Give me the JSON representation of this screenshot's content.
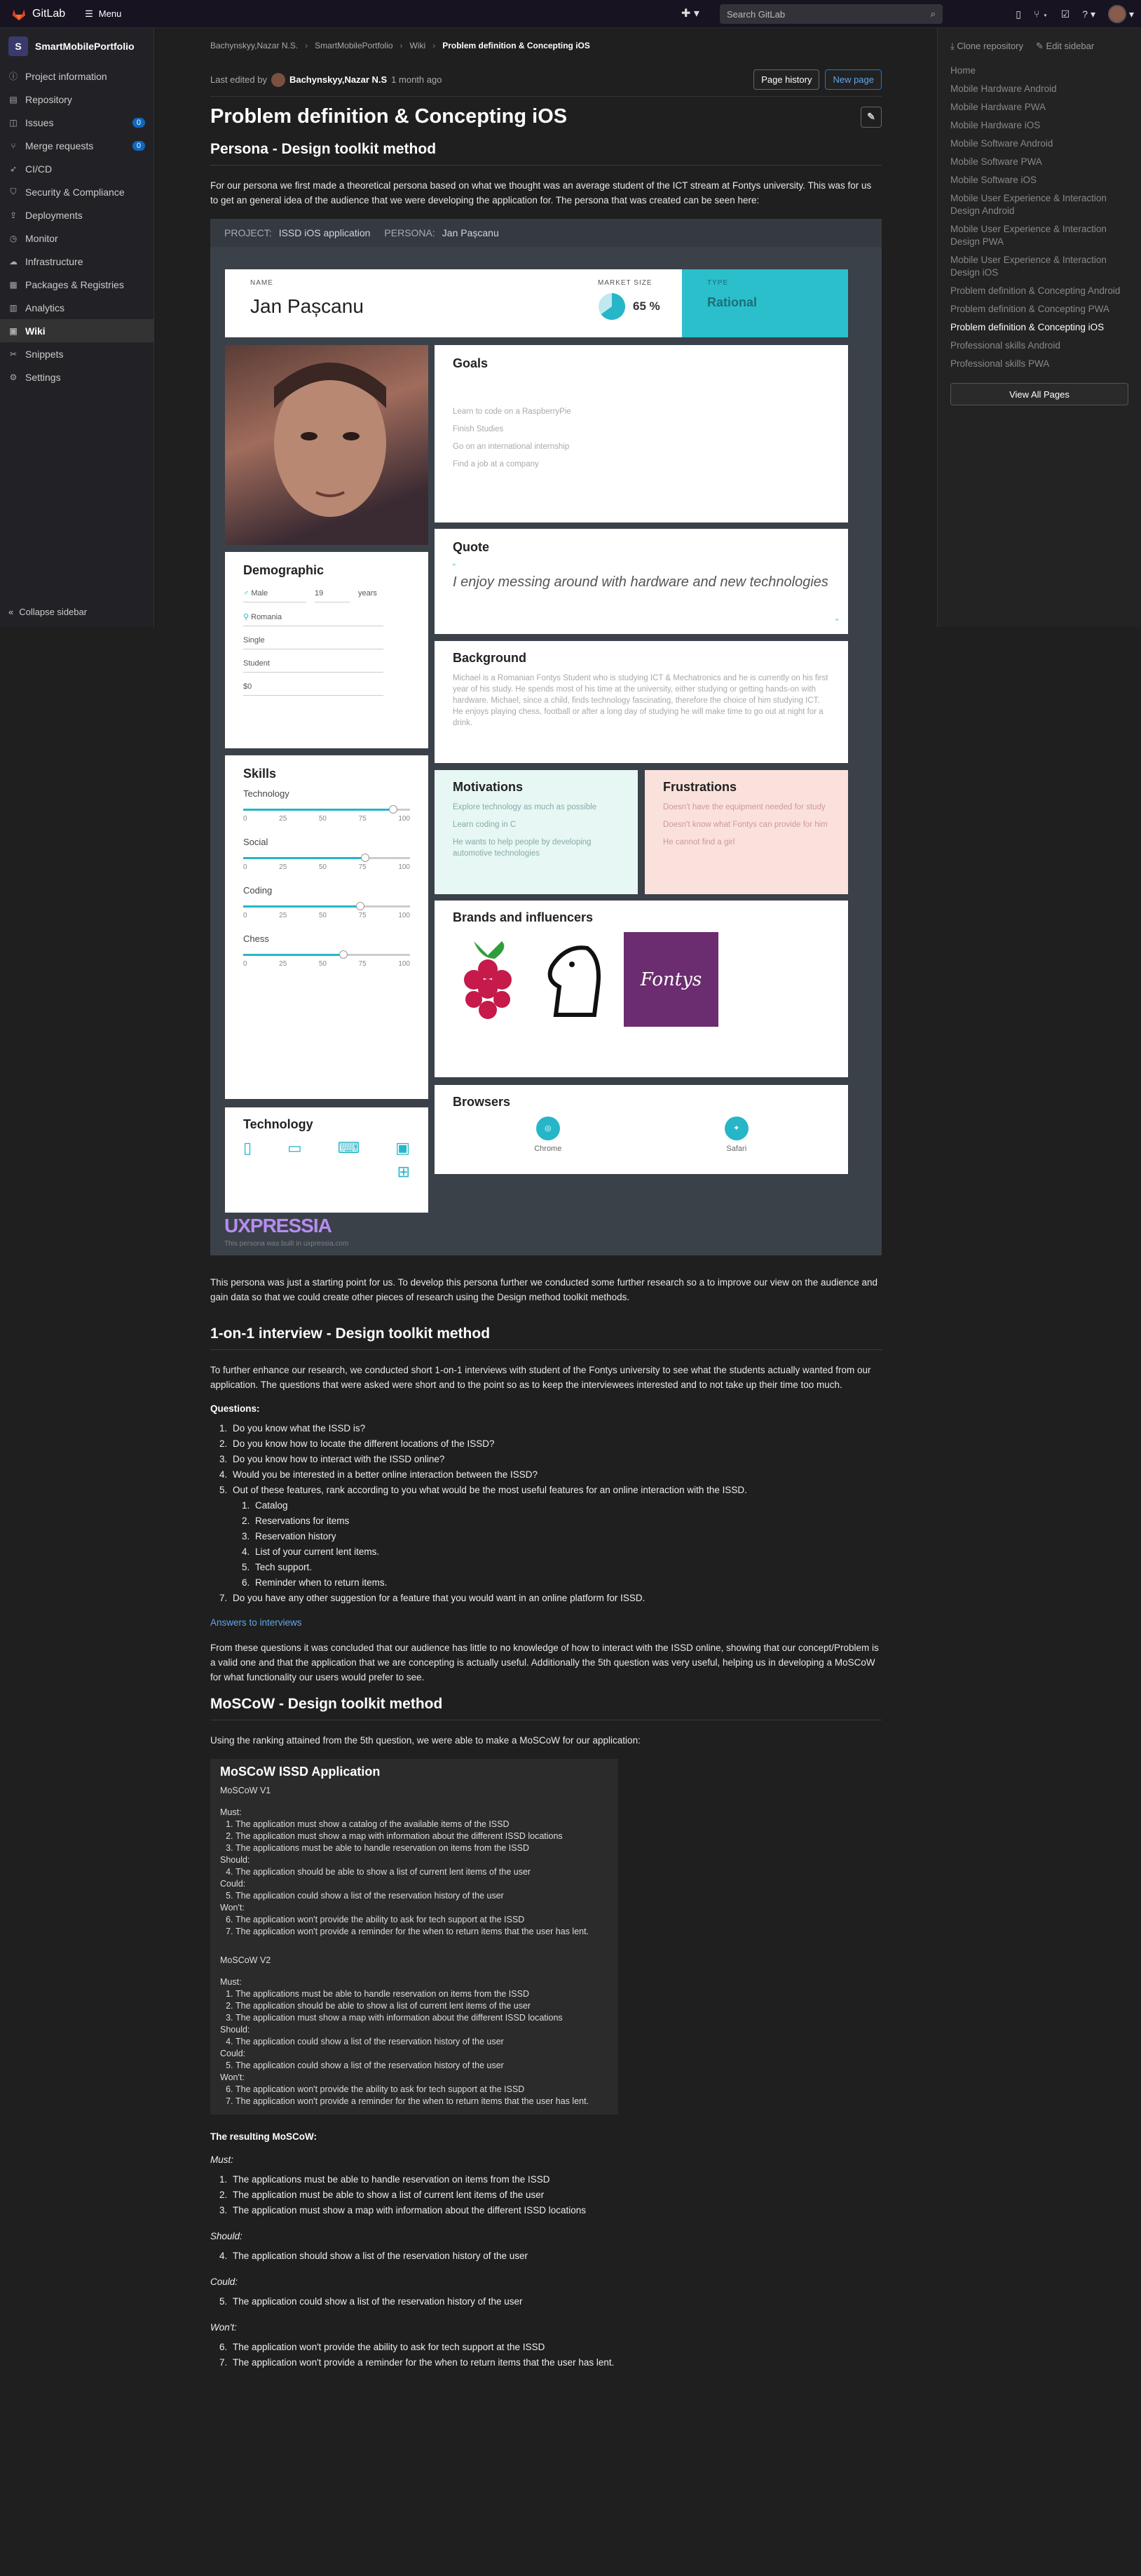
{
  "topbar": {
    "brand": "GitLab",
    "menu": "Menu",
    "search_placeholder": "Search GitLab"
  },
  "sidebar": {
    "project_letter": "S",
    "project_name": "SmartMobilePortfolio",
    "items": [
      {
        "label": "Project information",
        "icon": "info-icon"
      },
      {
        "label": "Repository",
        "icon": "doc-icon"
      },
      {
        "label": "Issues",
        "icon": "issues-icon",
        "badge": "0"
      },
      {
        "label": "Merge requests",
        "icon": "merge-icon",
        "badge": "0"
      },
      {
        "label": "CI/CD",
        "icon": "rocket-icon"
      },
      {
        "label": "Security & Compliance",
        "icon": "shield-icon"
      },
      {
        "label": "Deployments",
        "icon": "deploy-icon"
      },
      {
        "label": "Monitor",
        "icon": "monitor-icon"
      },
      {
        "label": "Infrastructure",
        "icon": "cloud-icon"
      },
      {
        "label": "Packages & Registries",
        "icon": "package-icon"
      },
      {
        "label": "Analytics",
        "icon": "chart-icon"
      },
      {
        "label": "Wiki",
        "icon": "book-icon",
        "active": true
      },
      {
        "label": "Snippets",
        "icon": "snippet-icon"
      },
      {
        "label": "Settings",
        "icon": "gear-icon"
      }
    ],
    "collapse": "Collapse sidebar"
  },
  "breadcrumb": [
    "Bachynskyy,Nazar N.S.",
    "SmartMobilePortfolio",
    "Wiki",
    "Problem definition & Concepting iOS"
  ],
  "editbar": {
    "prefix": "Last edited by",
    "author": "Bachynskyy,Nazar N.S",
    "when": "1 month ago",
    "page_history": "Page history",
    "new_page": "New page"
  },
  "rightbar": {
    "clone": "Clone repository",
    "edit": "Edit sidebar",
    "links": [
      "Home",
      "Mobile Hardware Android",
      "Mobile Hardware PWA",
      "Mobile Hardware iOS",
      "Mobile Software Android",
      "Mobile Software PWA",
      "Mobile Software iOS",
      "Mobile User Experience & Interaction Design Android",
      "Mobile User Experience & Interaction Design PWA",
      "Mobile User Experience & Interaction Design iOS",
      "Problem definition & Concepting Android",
      "Problem definition & Concepting PWA",
      "Problem definition & Concepting iOS",
      "Professional skills Android",
      "Professional skills PWA"
    ],
    "view_all": "View All Pages"
  },
  "page": {
    "title": "Problem definition & Concepting iOS",
    "h_persona": "Persona - Design toolkit method",
    "p_persona": "For our persona we first made a theoretical persona based on what we thought was an average student of the ICT stream at Fontys university. This was for us to get an general idea of the audience that we were developing the application for. The persona that was created can be seen here:",
    "p_after_persona": "This persona was just a starting point for us. To develop this persona further we conducted some further research so a to improve our view on the audience and gain data so that we could create other pieces of research using the Design method toolkit methods.",
    "h_interview": "1-on-1 interview - Design toolkit method",
    "p_interview": "To further enhance our research, we conducted short 1-on-1 interviews with student of the Fontys university to see what the students actually wanted from our application. The questions that were asked were short and to the point so as to keep the interviewees interested and to not take up their time too much.",
    "questions_label": "Questions:",
    "questions": [
      "Do you know what the ISSD is?",
      "Do you know how to locate the different locations of the ISSD?",
      "Do you know how to interact with the ISSD online?",
      "Would you be interested in a better online interaction between the ISSD?",
      "Out of these features, rank according to you what would be the most useful features for an online interaction with the ISSD.",
      "Do you have any other suggestion for a feature that you would want in an online platform for ISSD."
    ],
    "features": [
      "Catalog",
      "Reservations for items",
      "Reservation history",
      "List of your current lent items.",
      "Tech support.",
      "Reminder when to return items."
    ],
    "answers_link": "Answers to interviews",
    "p_conclusion": "From these questions it was concluded that our audience has little to no knowledge of how to interact with the ISSD online, showing that our concept/Problem is a valid one and that the application that we are concepting is actually useful. Additionally the 5th question was very useful, helping us in developing a MoSCoW for what functionality our users would prefer to see.",
    "h_moscow": "MoSCoW - Design toolkit method",
    "p_moscow": "Using the ranking attained from the 5th question, we were able to make a MoSCoW for our application:",
    "resulting_label": "The resulting MoSCoW:",
    "must_label": "Must:",
    "must": [
      "The applications must be able to handle reservation on items from the ISSD",
      "The application must be able to show a list of current lent items of the user",
      "The application must show a map with information about the different ISSD locations"
    ],
    "should_label": "Should:",
    "should": [
      "The application should show a list of the reservation history of the user"
    ],
    "could_label": "Could:",
    "could": [
      "The application could show a list of the reservation history of the user"
    ],
    "wont_label": "Won't:",
    "wont": [
      "The application won't provide the ability to ask for tech support at the ISSD",
      "The application won't provide a reminder for the when to return items that the user has lent."
    ]
  },
  "codeblock": {
    "title": "MoSCoW ISSD Application",
    "v1": "MoSCoW V1",
    "v2": "MoSCoW V2",
    "must": "Must:",
    "should": "Should:",
    "could": "Could:",
    "wont": "Won't:",
    "v1_must": [
      "The application must show a catalog of the available items of the ISSD",
      "The application must show a map with information about the different ISSD locations",
      "The applications must be able to handle reservation on items from the ISSD"
    ],
    "v1_should": [
      "The application should be able to show a list of current lent items of the user"
    ],
    "v1_could": [
      "The application could show a list of the reservation history of the user"
    ],
    "v1_wont": [
      "The application won't provide the ability to ask for tech support at the ISSD",
      "The application won't provide a reminder for the when to return items that the user has lent."
    ],
    "v2_must": [
      "The applications must be able to handle reservation on items from the ISSD",
      "The application should be able to show a list of current lent items of the user",
      "The application must show a map with information about the different ISSD locations"
    ],
    "v2_should": [
      "The application could show a list of the reservation history of the user"
    ],
    "v2_could": [
      "The application could show a list of the reservation history of the user"
    ],
    "v2_wont": [
      "The application won't provide the ability to ask for tech support at the ISSD",
      "The application won't provide a reminder for the when to return items that the user has lent."
    ]
  },
  "persona": {
    "project_label": "PROJECT:",
    "project": "ISSD iOS application",
    "persona_label": "PERSONA:",
    "persona_name": "Jan Pașcanu",
    "name_label": "NAME",
    "name": "Jan Pașcanu",
    "market_label": "MARKET SIZE",
    "market_value": "65 %",
    "market_fraction": 0.65,
    "type_label": "TYPE",
    "type": "Rational",
    "goals_h": "Goals",
    "goals": [
      "Learn to code on a RaspberryPie",
      "Finish Studies",
      "Go on an international internship",
      "Find a job at a company"
    ],
    "quote_h": "Quote",
    "quote": "I enjoy messing around with hardware and new technologies",
    "demo_h": "Demographic",
    "gender": "Male",
    "age": "19",
    "age_unit": "years",
    "location": "Romania",
    "status": "Single",
    "occupation": "Student",
    "income": "$0",
    "bg_h": "Background",
    "bg": "Michael is a Romanian Fontys Student who is studying ICT & Mechatronics and he is currently on his first year of his study. He spends most of his time at the university, either studying or getting hands-on with hardware. Michael, since a child, finds technology fascinating, therefore the choice of him studying ICT. He enjoys playing chess, football or after a long day of studying he will make time to go out at night for a drink.",
    "skills_h": "Skills",
    "skills": [
      {
        "name": "Technology",
        "value": 90
      },
      {
        "name": "Social",
        "value": 73
      },
      {
        "name": "Coding",
        "value": 70
      },
      {
        "name": "Chess",
        "value": 60
      }
    ],
    "tick_labels": [
      "0",
      "25",
      "50",
      "75",
      "100"
    ],
    "motiv_h": "Motivations",
    "motiv": [
      "Explore technology as much as possible",
      "Learn coding in C",
      "He wants to help people by developing automotive technologies"
    ],
    "frust_h": "Frustrations",
    "frust": [
      "Doesn't have the equipment needed for study",
      "Doesn't know what Fontys can provide for him",
      "He cannot find a girl"
    ],
    "brands_h": "Brands and influencers",
    "fontys": "Fontys",
    "tech_h": "Technology",
    "browsers_h": "Browsers",
    "browsers": [
      "Chrome",
      "Safari"
    ],
    "footer_logo": "UXPRESSIA",
    "footer_note": "This persona was built in uxpressia.com"
  }
}
